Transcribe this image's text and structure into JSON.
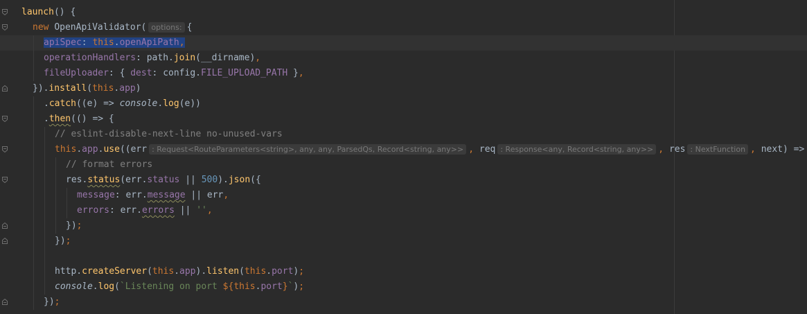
{
  "editor": {
    "lines": [
      {
        "indent": 0,
        "fold": "open",
        "tokens": [
          {
            "t": "launch",
            "c": "fn"
          },
          {
            "t": "() {",
            "c": "plain"
          }
        ]
      },
      {
        "indent": 1,
        "fold": "open",
        "tokens": [
          {
            "t": "new ",
            "c": "kw"
          },
          {
            "t": "OpenApiValidator(",
            "c": "plain"
          },
          {
            "t": "options:",
            "c": "hint"
          },
          {
            "t": "{",
            "c": "plain"
          }
        ]
      },
      {
        "indent": 2,
        "current": true,
        "tokens": [
          {
            "t": "apiSpec",
            "c": "prop sel"
          },
          {
            "t": ": ",
            "c": "plain sel"
          },
          {
            "t": "this",
            "c": "kw sel"
          },
          {
            "t": ".",
            "c": "plain sel"
          },
          {
            "t": "openApiPath",
            "c": "prop sel"
          },
          {
            "t": ",",
            "c": "kw sel"
          }
        ]
      },
      {
        "indent": 2,
        "tokens": [
          {
            "t": "operationHandlers",
            "c": "prop"
          },
          {
            "t": ": path.",
            "c": "plain"
          },
          {
            "t": "join",
            "c": "fn"
          },
          {
            "t": "(__dirname)",
            "c": "plain"
          },
          {
            "t": ",",
            "c": "kw"
          }
        ]
      },
      {
        "indent": 2,
        "tokens": [
          {
            "t": "fileUploader",
            "c": "prop"
          },
          {
            "t": ": { ",
            "c": "plain"
          },
          {
            "t": "dest",
            "c": "prop"
          },
          {
            "t": ": config.",
            "c": "plain"
          },
          {
            "t": "FILE_UPLOAD_PATH",
            "c": "prop"
          },
          {
            "t": " }",
            "c": "plain"
          },
          {
            "t": ",",
            "c": "kw"
          }
        ]
      },
      {
        "indent": 1,
        "fold": "close",
        "tokens": [
          {
            "t": "}).",
            "c": "plain"
          },
          {
            "t": "install",
            "c": "fn"
          },
          {
            "t": "(",
            "c": "plain"
          },
          {
            "t": "this",
            "c": "kw"
          },
          {
            "t": ".",
            "c": "plain"
          },
          {
            "t": "app",
            "c": "prop"
          },
          {
            "t": ")",
            "c": "plain"
          }
        ]
      },
      {
        "indent": 2,
        "tokens": [
          {
            "t": ".",
            "c": "plain"
          },
          {
            "t": "catch",
            "c": "fn"
          },
          {
            "t": "((e) => ",
            "c": "plain"
          },
          {
            "t": "console",
            "c": "prop ital"
          },
          {
            "t": ".",
            "c": "plain"
          },
          {
            "t": "log",
            "c": "fn"
          },
          {
            "t": "(e))",
            "c": "plain"
          }
        ]
      },
      {
        "indent": 2,
        "fold": "open",
        "tokens": [
          {
            "t": ".",
            "c": "plain"
          },
          {
            "t": "then",
            "c": "fn squiggle"
          },
          {
            "t": "(() => {",
            "c": "plain"
          }
        ]
      },
      {
        "indent": 3,
        "tokens": [
          {
            "t": "// eslint-disable-next-line no-unused-vars",
            "c": "cmt"
          }
        ]
      },
      {
        "indent": 3,
        "fold": "open",
        "tokens": [
          {
            "t": "this",
            "c": "kw"
          },
          {
            "t": ".",
            "c": "plain"
          },
          {
            "t": "app",
            "c": "prop"
          },
          {
            "t": ".",
            "c": "plain"
          },
          {
            "t": "use",
            "c": "fn"
          },
          {
            "t": "((err",
            "c": "plain"
          },
          {
            "t": ": Request<RouteParameters<string>, any, any, ParsedQs, Record<string, any>>",
            "c": "hint"
          },
          {
            "t": ", ",
            "c": "kw"
          },
          {
            "t": "req",
            "c": "plain"
          },
          {
            "t": ": Response<any, Record<string, any>>",
            "c": "hint"
          },
          {
            "t": ", ",
            "c": "kw"
          },
          {
            "t": "res",
            "c": "plain"
          },
          {
            "t": ": NextFunction",
            "c": "hint"
          },
          {
            "t": ", ",
            "c": "kw"
          },
          {
            "t": "next",
            "c": "plain"
          },
          {
            "t": ") => {",
            "c": "plain"
          }
        ]
      },
      {
        "indent": 4,
        "tokens": [
          {
            "t": "// format errors",
            "c": "cmt"
          }
        ]
      },
      {
        "indent": 4,
        "fold": "open",
        "tokens": [
          {
            "t": "res.",
            "c": "plain"
          },
          {
            "t": "status",
            "c": "fn squiggle"
          },
          {
            "t": "(err.",
            "c": "plain"
          },
          {
            "t": "status",
            "c": "prop"
          },
          {
            "t": " || ",
            "c": "plain"
          },
          {
            "t": "500",
            "c": "num"
          },
          {
            "t": ").",
            "c": "plain"
          },
          {
            "t": "json",
            "c": "fn"
          },
          {
            "t": "({",
            "c": "plain"
          }
        ]
      },
      {
        "indent": 5,
        "tokens": [
          {
            "t": "message",
            "c": "prop"
          },
          {
            "t": ": err.",
            "c": "plain"
          },
          {
            "t": "message",
            "c": "prop squiggle"
          },
          {
            "t": " || err",
            "c": "plain"
          },
          {
            "t": ",",
            "c": "kw"
          }
        ]
      },
      {
        "indent": 5,
        "tokens": [
          {
            "t": "errors",
            "c": "prop"
          },
          {
            "t": ": err.",
            "c": "plain"
          },
          {
            "t": "errors",
            "c": "prop squiggle"
          },
          {
            "t": " || ",
            "c": "plain"
          },
          {
            "t": "''",
            "c": "str"
          },
          {
            "t": ",",
            "c": "kw"
          }
        ]
      },
      {
        "indent": 4,
        "fold": "close",
        "tokens": [
          {
            "t": "})",
            "c": "plain"
          },
          {
            "t": ";",
            "c": "kw"
          }
        ]
      },
      {
        "indent": 3,
        "fold": "close",
        "tokens": [
          {
            "t": "})",
            "c": "plain"
          },
          {
            "t": ";",
            "c": "kw"
          }
        ]
      },
      {
        "indent": 3,
        "tokens": []
      },
      {
        "indent": 3,
        "tokens": [
          {
            "t": "http.",
            "c": "plain"
          },
          {
            "t": "createServer",
            "c": "fn"
          },
          {
            "t": "(",
            "c": "plain"
          },
          {
            "t": "this",
            "c": "kw"
          },
          {
            "t": ".",
            "c": "plain"
          },
          {
            "t": "app",
            "c": "prop"
          },
          {
            "t": ").",
            "c": "plain"
          },
          {
            "t": "listen",
            "c": "fn"
          },
          {
            "t": "(",
            "c": "plain"
          },
          {
            "t": "this",
            "c": "kw"
          },
          {
            "t": ".",
            "c": "plain"
          },
          {
            "t": "port",
            "c": "prop"
          },
          {
            "t": ")",
            "c": "plain"
          },
          {
            "t": ";",
            "c": "kw"
          }
        ]
      },
      {
        "indent": 3,
        "tokens": [
          {
            "t": "console",
            "c": "prop ital"
          },
          {
            "t": ".",
            "c": "plain"
          },
          {
            "t": "log",
            "c": "fn"
          },
          {
            "t": "(",
            "c": "plain"
          },
          {
            "t": "`Listening on port ",
            "c": "str"
          },
          {
            "t": "${",
            "c": "kw"
          },
          {
            "t": "this",
            "c": "kw"
          },
          {
            "t": ".",
            "c": "plain"
          },
          {
            "t": "port",
            "c": "prop"
          },
          {
            "t": "}",
            "c": "kw"
          },
          {
            "t": "`",
            "c": "str"
          },
          {
            "t": ")",
            "c": "plain"
          },
          {
            "t": ";",
            "c": "kw"
          }
        ]
      },
      {
        "indent": 2,
        "fold": "close",
        "tokens": [
          {
            "t": "})",
            "c": "plain"
          },
          {
            "t": ";",
            "c": "kw"
          }
        ]
      }
    ]
  }
}
